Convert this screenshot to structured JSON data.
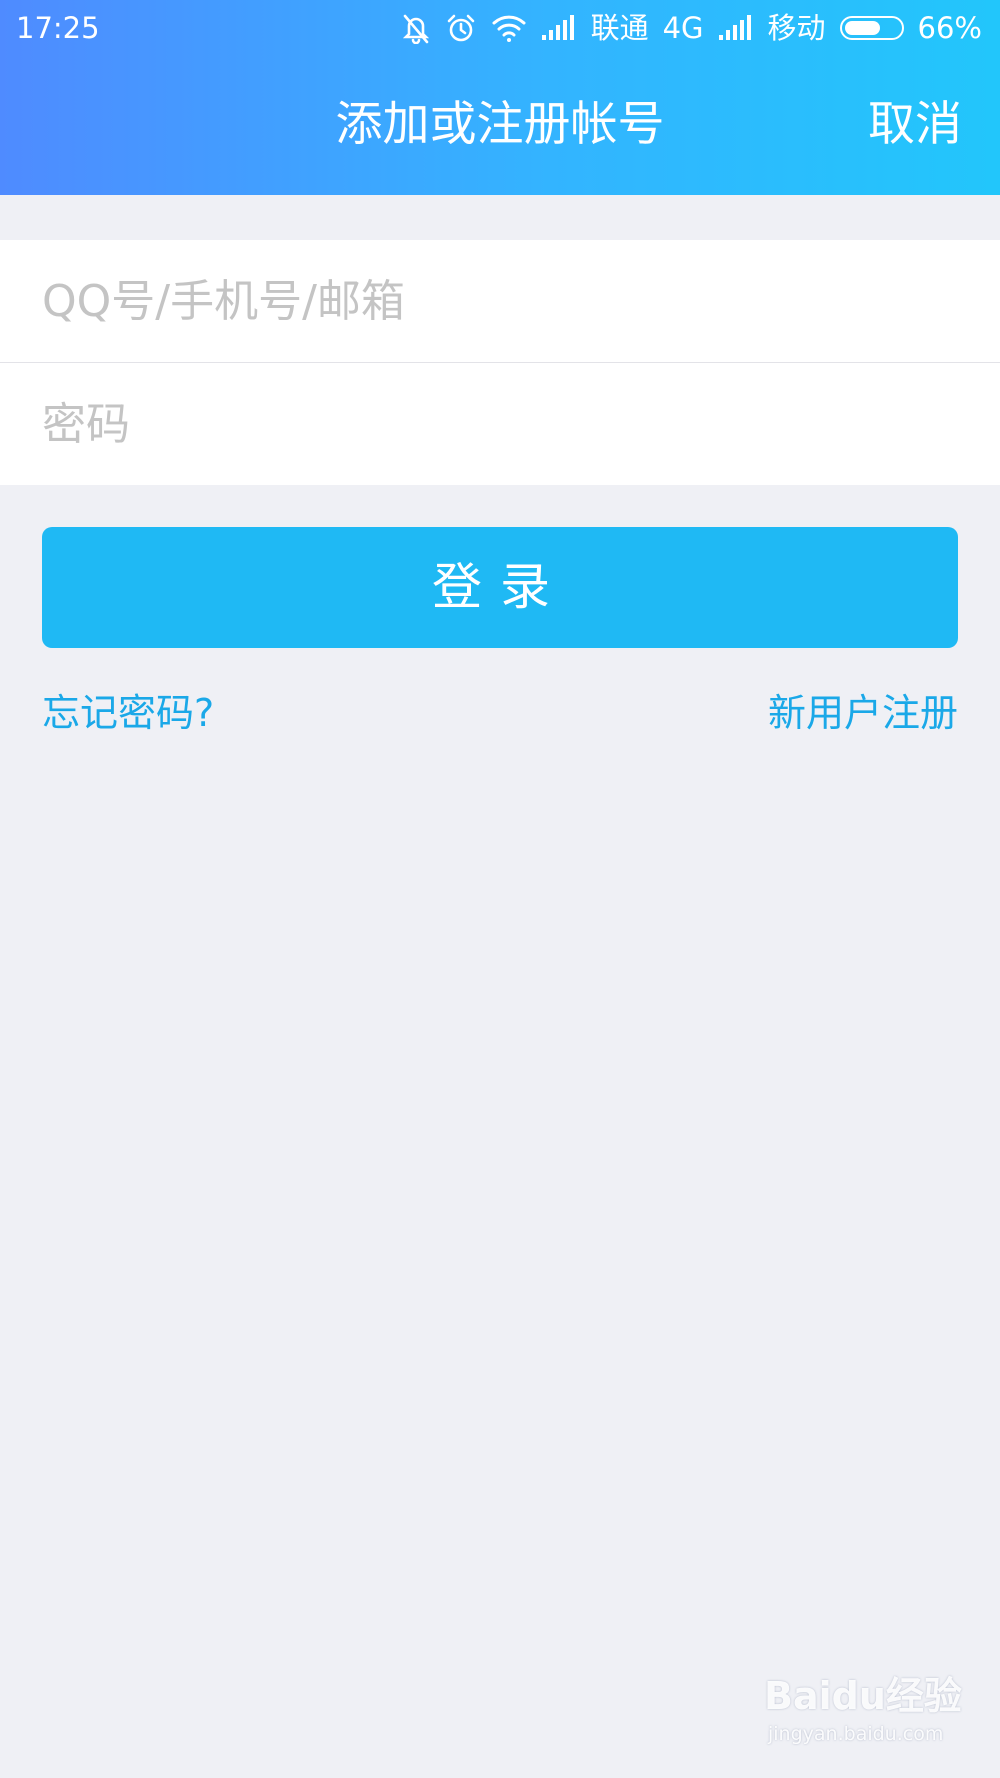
{
  "status_bar": {
    "time": "17:25",
    "carrier1": "联通",
    "network1": "4G",
    "carrier2": "移动",
    "battery_percent": "66%",
    "battery_level": 0.66,
    "icons": [
      "bell-muted-icon",
      "alarm-icon",
      "wifi-icon",
      "signal-icon",
      "signal-icon",
      "battery-icon"
    ]
  },
  "header": {
    "title": "添加或注册帐号",
    "cancel_label": "取消"
  },
  "form": {
    "account_placeholder": "QQ号/手机号/邮箱",
    "account_value": "",
    "password_placeholder": "密码",
    "password_value": ""
  },
  "actions": {
    "login_label": "登录",
    "forgot_label": "忘记密码?",
    "register_label": "新用户注册"
  },
  "watermark": {
    "brand": "Baidu经验",
    "site": "jingyan.baidu.com"
  },
  "colors": {
    "header_gradient_start": "#4f8bff",
    "header_gradient_end": "#22c6fb",
    "login_button": "#1fb9f4",
    "link": "#1aa8e8",
    "background": "#eff0f5"
  }
}
